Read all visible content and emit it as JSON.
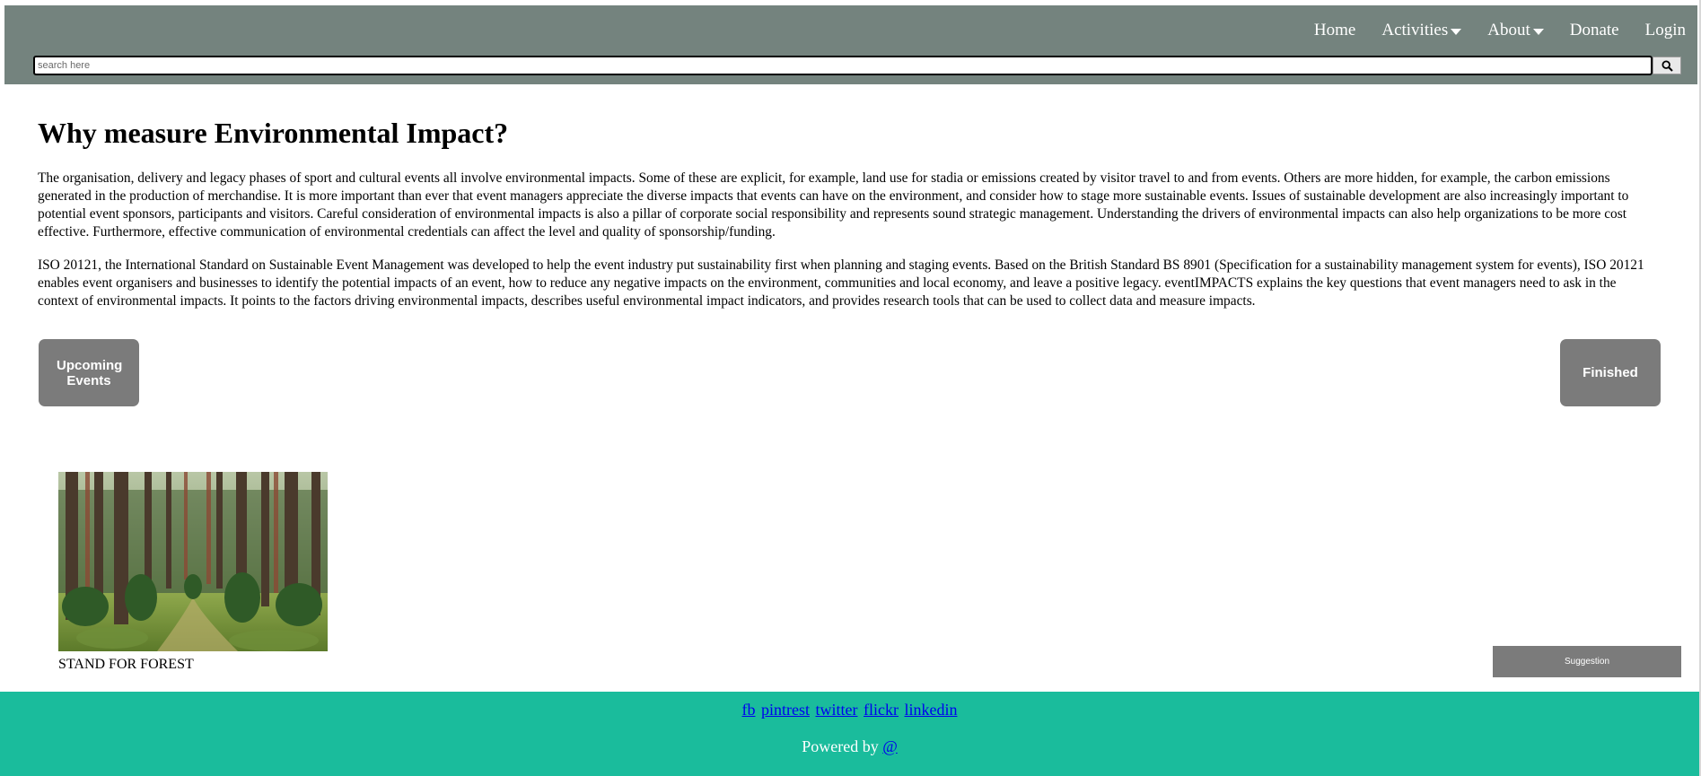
{
  "header": {
    "nav": {
      "home": "Home",
      "activities": "Activities",
      "about": "About",
      "donate": "Donate",
      "login": "Login"
    },
    "search": {
      "placeholder": "search here",
      "button_icon": "search-icon"
    },
    "colors": {
      "background": "#74837e"
    }
  },
  "main": {
    "title": "Why measure Environmental Impact?",
    "paragraphs": [
      "The organisation, delivery and legacy phases of sport and cultural events all involve environmental impacts. Some of these are explicit, for example, land use for stadia or emissions created by visitor travel to and from events. Others are more hidden, for example, the carbon emissions generated in the production of merchandise. It is more important than ever that event managers appreciate the diverse impacts that events can have on the environment, and consider how to stage more sustainable events. Issues of sustainable development are also increasingly important to potential event sponsors, participants and visitors. Careful consideration of environmental impacts is also a pillar of corporate social responsibility and represents sound strategic management. Understanding the drivers of environmental impacts can also help organizations to be more cost effective. Furthermore, effective communication of environmental credentials can affect the level and quality of sponsorship/funding.",
      "ISO 20121, the International Standard on Sustainable Event Management was developed to help the event industry put sustainability first when planning and staging events. Based on the British Standard BS 8901 (Specification for a sustainability management system for events), ISO 20121 enables event organisers and businesses to identify the potential impacts of an event, how to reduce any negative impacts on the environment, communities and local economy, and leave a positive legacy. eventIMPACTS explains the key questions that event managers need to ask in the context of environmental impacts. It points to the factors driving environmental impacts, describes useful environmental impact indicators, and provides research tools that can be used to collect data and measure impacts."
    ],
    "buttons": {
      "upcoming": "Upcoming Events",
      "finished": "Finished"
    },
    "card": {
      "caption": "STAND FOR FOREST"
    },
    "suggestion": "Suggestion"
  },
  "footer": {
    "social": [
      "fb",
      "pintrest",
      "twitter",
      "flickr",
      "linkedin"
    ],
    "powered_label": "Powered by",
    "powered_link": "@",
    "colors": {
      "background": "#1abc9c"
    }
  }
}
